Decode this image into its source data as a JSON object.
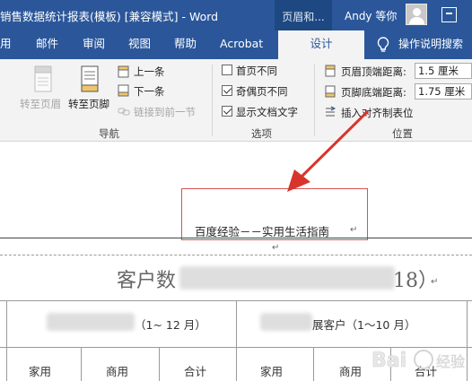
{
  "titlebar": {
    "title": "销售数据统计报表(模板) [兼容模式] - Word",
    "context_tab": "页眉和...",
    "user": "Andy 等你",
    "colors": {
      "accent": "#2b579a",
      "context": "#1d4882"
    }
  },
  "tabs": [
    {
      "label": "用"
    },
    {
      "label": "邮件"
    },
    {
      "label": "审阅"
    },
    {
      "label": "视图"
    },
    {
      "label": "帮助"
    },
    {
      "label": "Acrobat"
    },
    {
      "label": "设计"
    }
  ],
  "tell_me": "操作说明搜索",
  "ribbon": {
    "nav": {
      "goto_header": "转至页眉",
      "goto_footer": "转至页脚",
      "previous": "上一条",
      "next": "下一条",
      "link_previous": "链接到前一节",
      "group": "导航"
    },
    "options": {
      "diff_first": "首页不同",
      "diff_first_checked": false,
      "diff_odd_even": "奇偶页不同",
      "diff_odd_even_checked": true,
      "show_doc_text": "显示文档文字",
      "show_doc_text_checked": true,
      "group": "选项"
    },
    "position": {
      "header_top_label": "页眉顶端距离:",
      "header_top_value": "1.5 厘米",
      "footer_bottom_label": "页脚底端距离:",
      "footer_bottom_value": "1.75 厘米",
      "insert_align_tab": "插入对齐制表位",
      "group": "位置"
    }
  },
  "document": {
    "header_text": "百度经验－－实用生活指南",
    "header_mark": "↵",
    "para_mark": "↵",
    "title": "客户数",
    "title_end": "18）",
    "table": {
      "group1_label": "（1~ 12 月）",
      "group2_label": "展客户（1～10 月）",
      "cols": [
        "家用",
        "商用",
        "合计",
        "家用",
        "商用",
        "合计"
      ]
    },
    "watermark": "Bai 经验"
  }
}
